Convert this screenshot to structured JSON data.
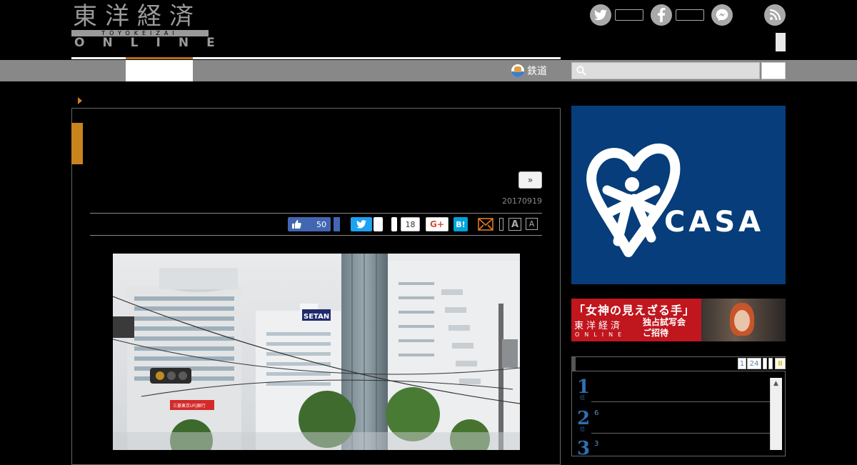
{
  "header": {
    "logo_kanji": "東洋経済",
    "logo_romaji": "TOYOKEIZAI",
    "logo_online": "ONLINE",
    "nav_tetsudo": "鉄道"
  },
  "article": {
    "next_label": "»",
    "date": "20170919",
    "like_count": "50",
    "pocket_count": "18",
    "gplus_label": "G+",
    "hatena_label": "B!",
    "font_large": "A",
    "font_small": "A",
    "photo_sign": "SETAN",
    "photo_bank_sign": "三菱東京UFJ銀行"
  },
  "sidebar": {
    "ad_casa_text": "CASA",
    "banner": {
      "title": "「女神の見えざる手」",
      "logo": "東洋経済",
      "online": "ONLINE",
      "sub_line1": "独占試写会",
      "sub_line2": "ご招待"
    },
    "ranking": {
      "tabs": [
        "1",
        "24"
      ],
      "tab_end": "II",
      "items": [
        {
          "rank": "1",
          "suffix": "位",
          "count": ""
        },
        {
          "rank": "2",
          "suffix": "位",
          "count": "6"
        },
        {
          "rank": "3",
          "suffix": "位",
          "count": "3"
        }
      ]
    }
  },
  "colors": {
    "accent": "#c8841e",
    "facebook": "#4267b2",
    "twitter": "#1da1f2",
    "hatena": "#00a4de",
    "casa_blue": "#063d7a",
    "banner_red": "#c0161e",
    "rank_blue": "#2f6fb1"
  }
}
